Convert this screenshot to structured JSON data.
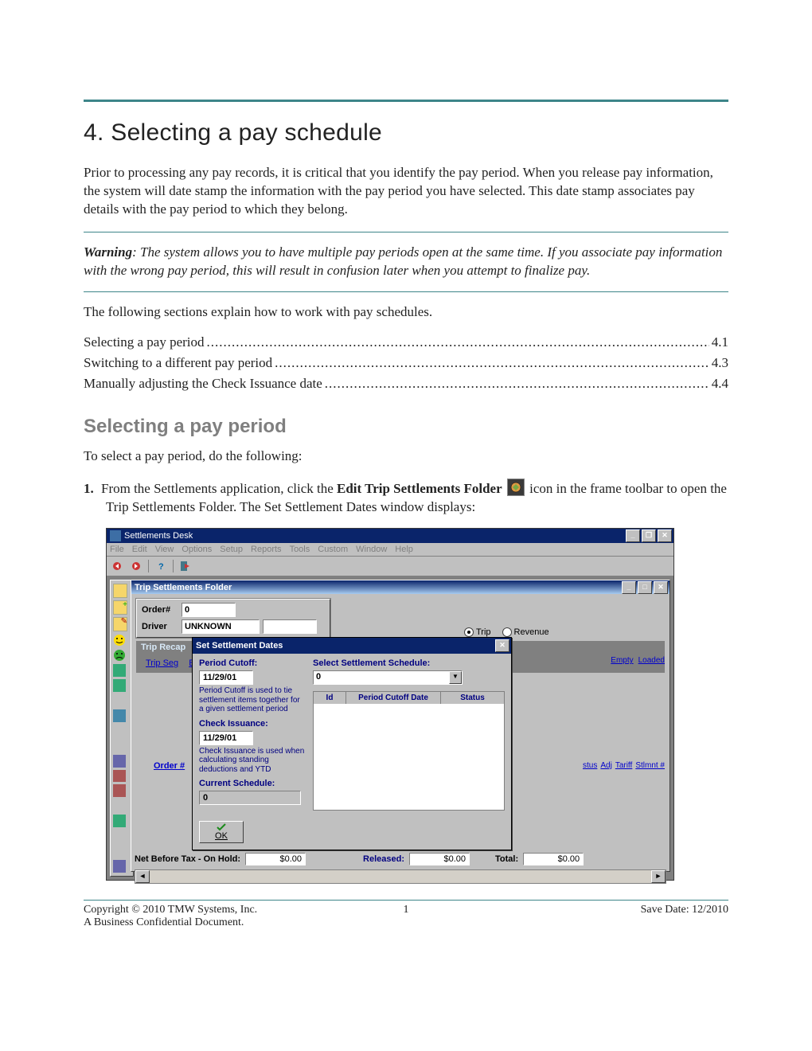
{
  "chapter_title": "4.  Selecting a pay schedule",
  "intro": "Prior to processing any pay records, it is critical that you identify the pay period. When you release pay information, the system will date stamp the information with the pay period you have selected. This date stamp associates pay details with the pay period to which they belong.",
  "warning_label": "Warning",
  "warning_text": ": The system allows you to have multiple pay periods open at the same time. If you associate pay information with the wrong pay period, this will result in confusion later when you attempt to finalize pay.",
  "lead_out": "The following sections explain how to work with pay schedules.",
  "toc": [
    {
      "label": "Selecting a pay period",
      "page": "4.1"
    },
    {
      "label": "Switching to a different pay period",
      "page": "4.3"
    },
    {
      "label": "Manually adjusting the Check Issuance date",
      "page": "4.4"
    }
  ],
  "section_title": "Selecting a pay period",
  "section_lead": "To select a pay period, do the following:",
  "step1_num": "1.",
  "step1_a": "From the Settlements application, click the ",
  "step1_bold": "Edit Trip Settlements Folder",
  "step1_b": " icon in the frame toolbar to open the Trip Settlements Folder. The Set Settlement Dates window displays:",
  "app": {
    "title": "Settlements Desk",
    "menus": [
      "File",
      "Edit",
      "View",
      "Options",
      "Setup",
      "Reports",
      "Tools",
      "Custom",
      "Window",
      "Help"
    ],
    "inner_title": "Trip Settlements Folder",
    "order_label": "Order#",
    "order_value": "0",
    "driver_label": "Driver",
    "driver_value": "UNKNOWN",
    "tab_trip_recap": "Trip Recap",
    "tab_trip_seg": "Trip Seg",
    "tab_trip_seg_e": "E",
    "radio_trip": "Trip",
    "radio_revenue": "Revenue",
    "right_hdrs": [
      "Empty",
      "Loaded"
    ],
    "right_hdrs2": [
      "stus",
      "Adj",
      "Tariff",
      "Stlmnt #"
    ],
    "order_link": "Order #",
    "status_netlabel": "Net Before Tax -  On Hold:",
    "status_onhold_val": "$0.00",
    "status_released_label": "Released:",
    "status_released_val": "$0.00",
    "status_total_label": "Total:",
    "status_total_val": "$0.00"
  },
  "dlg": {
    "title": "Set Settlement Dates",
    "period_cutoff_label": "Period Cutoff:",
    "period_cutoff_value": "11/29/01",
    "period_cutoff_help": "Period Cutoff is used to tie settlement items together for a given settlement period",
    "check_issuance_label": "Check Issuance:",
    "check_issuance_value": "11/29/01",
    "check_issuance_help": "Check Issuance is used when calculating standing deductions and YTD",
    "current_schedule_label": "Current Schedule:",
    "current_schedule_value": "0",
    "select_label": "Select Settlement Schedule:",
    "combo_value": "0",
    "grid_cols": [
      "Id",
      "Period Cutoff Date",
      "Status"
    ],
    "ok_label": "OK"
  },
  "footer": {
    "copyright": "Copyright © 2010 TMW Systems, Inc.",
    "confidential": "A Business Confidential Document.",
    "page_num": "1",
    "save_date": "Save Date: 12/2010"
  }
}
